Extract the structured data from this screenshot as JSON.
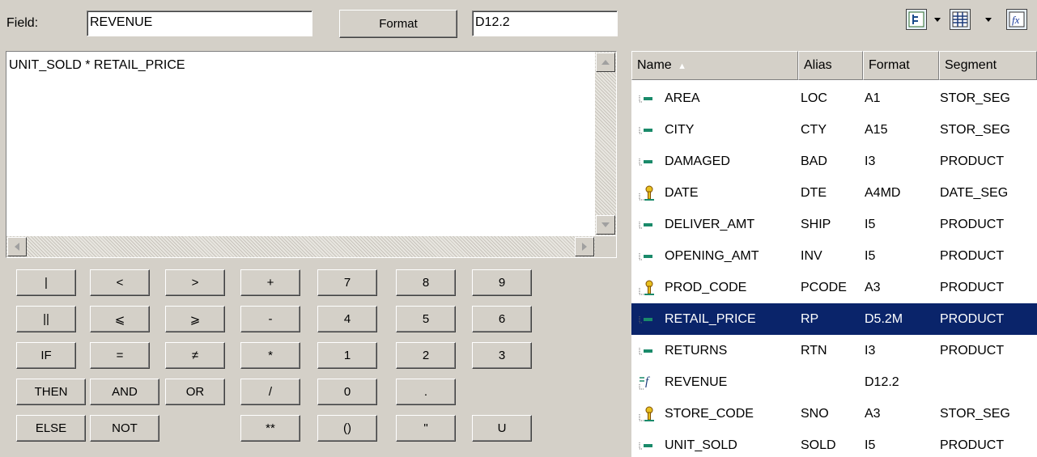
{
  "field": {
    "label": "Field:",
    "value": "REVENUE",
    "format_button": "Format",
    "format_value": "D12.2"
  },
  "editor": {
    "expression": "UNIT_SOLD * RETAIL_PRICE"
  },
  "keypad": [
    [
      "|",
      "<",
      ">",
      "+",
      "7",
      "8",
      "9"
    ],
    [
      "||",
      "⩽",
      "⩾",
      "-",
      "4",
      "5",
      "6"
    ],
    [
      "IF",
      "=",
      "≠",
      "*",
      "1",
      "2",
      "3"
    ],
    [
      "THEN",
      "AND",
      "OR",
      "/",
      "0",
      "."
    ],
    [
      "ELSE",
      "NOT",
      "**",
      "()",
      "\"",
      "U"
    ]
  ],
  "toolbar": {
    "icons": [
      "tree-view-icon",
      "column-view-icon",
      "function-icon"
    ]
  },
  "list": {
    "columns": [
      "Name",
      "Alias",
      "Format",
      "Segment"
    ],
    "sort_column": "Name",
    "rows": [
      {
        "icon": "field-icon",
        "name": "AREA",
        "alias": "LOC",
        "format": "A1",
        "segment": "STOR_SEG"
      },
      {
        "icon": "field-icon",
        "name": "CITY",
        "alias": "CTY",
        "format": "A15",
        "segment": "STOR_SEG"
      },
      {
        "icon": "field-icon",
        "name": "DAMAGED",
        "alias": "BAD",
        "format": "I3",
        "segment": "PRODUCT"
      },
      {
        "icon": "key-icon",
        "name": "DATE",
        "alias": "DTE",
        "format": "A4MD",
        "segment": "DATE_SEG"
      },
      {
        "icon": "field-icon",
        "name": "DELIVER_AMT",
        "alias": "SHIP",
        "format": "I5",
        "segment": "PRODUCT"
      },
      {
        "icon": "field-icon",
        "name": "OPENING_AMT",
        "alias": "INV",
        "format": "I5",
        "segment": "PRODUCT"
      },
      {
        "icon": "key-icon",
        "name": "PROD_CODE",
        "alias": "PCODE",
        "format": "A3",
        "segment": "PRODUCT"
      },
      {
        "icon": "field-icon",
        "name": "RETAIL_PRICE",
        "alias": "RP",
        "format": "D5.2M",
        "segment": "PRODUCT",
        "selected": true
      },
      {
        "icon": "field-icon",
        "name": "RETURNS",
        "alias": "RTN",
        "format": "I3",
        "segment": "PRODUCT"
      },
      {
        "icon": "computed-icon",
        "name": "REVENUE",
        "alias": "",
        "format": "D12.2",
        "segment": ""
      },
      {
        "icon": "key-icon",
        "name": "STORE_CODE",
        "alias": "SNO",
        "format": "A3",
        "segment": "STOR_SEG"
      },
      {
        "icon": "field-icon",
        "name": "UNIT_SOLD",
        "alias": "SOLD",
        "format": "I5",
        "segment": "PRODUCT"
      }
    ]
  },
  "colors": {
    "selection": "#0a246a",
    "window": "#d4d0c8"
  }
}
